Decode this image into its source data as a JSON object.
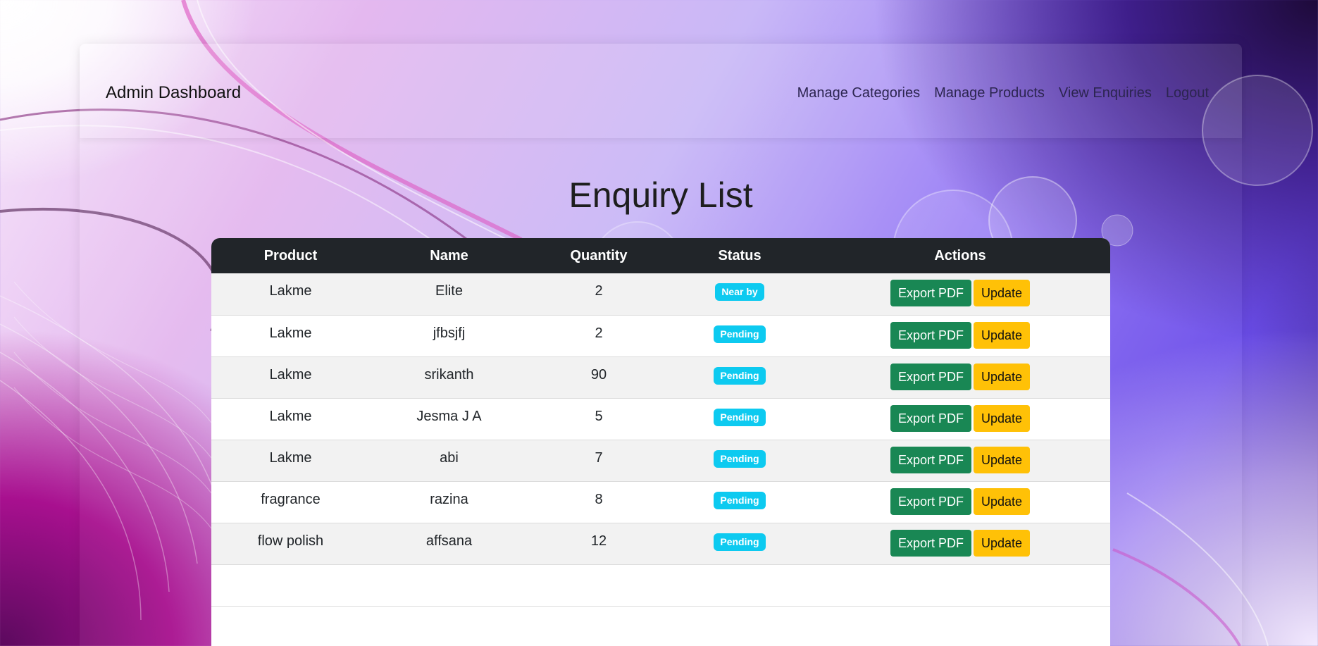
{
  "navbar": {
    "brand": "Admin Dashboard",
    "links": [
      "Manage Categories",
      "Manage Products",
      "View Enquiries",
      "Logout"
    ]
  },
  "page": {
    "title": "Enquiry List"
  },
  "table": {
    "headers": [
      "Product",
      "Name",
      "Quantity",
      "Status",
      "Actions"
    ],
    "export_label": "Export PDF",
    "update_label": "Update",
    "rows": [
      {
        "product": "Lakme",
        "name": "Elite",
        "quantity": "2",
        "status": "Near by"
      },
      {
        "product": "Lakme",
        "name": "jfbsjfj",
        "quantity": "2",
        "status": "Pending"
      },
      {
        "product": "Lakme",
        "name": "srikanth",
        "quantity": "90",
        "status": "Pending"
      },
      {
        "product": "Lakme",
        "name": "Jesma J A",
        "quantity": "5",
        "status": "Pending"
      },
      {
        "product": "Lakme",
        "name": "abi",
        "quantity": "7",
        "status": "Pending"
      },
      {
        "product": "fragrance",
        "name": "razina",
        "quantity": "8",
        "status": "Pending"
      },
      {
        "product": "flow polish",
        "name": "affsana",
        "quantity": "12",
        "status": "Pending"
      }
    ]
  },
  "colors": {
    "header_bg": "#212529",
    "badge": "#0dcaf0",
    "export_button": "#198754",
    "update_button": "#ffc107"
  }
}
